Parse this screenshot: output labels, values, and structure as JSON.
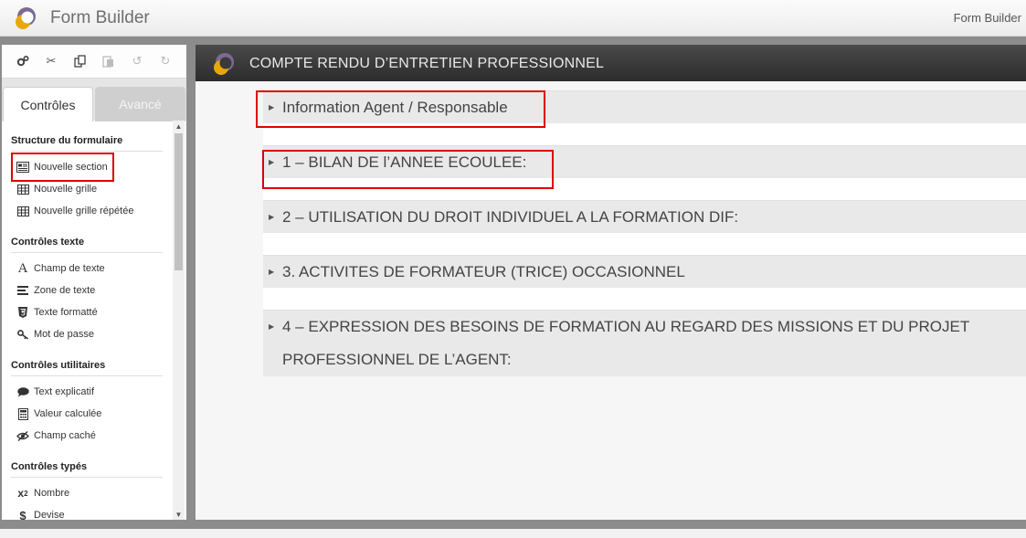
{
  "header": {
    "app_title": "Form Builder",
    "right_label": "Form Builder"
  },
  "toolbar": {
    "icons": [
      "settings-icon",
      "cut-icon",
      "copy-icon",
      "paste-icon",
      "undo-icon",
      "redo-icon"
    ]
  },
  "tabs": {
    "controls": "Contrôles",
    "advanced": "Avancé"
  },
  "sidebar": {
    "structure": {
      "title": "Structure du formulaire",
      "items": [
        "Nouvelle section",
        "Nouvelle grille",
        "Nouvelle grille répétée"
      ]
    },
    "text": {
      "title": "Contrôles texte",
      "items": [
        "Champ de texte",
        "Zone de texte",
        "Texte formatté",
        "Mot de passe"
      ]
    },
    "utility": {
      "title": "Contrôles utilitaires",
      "items": [
        "Text explicatif",
        "Valeur calculée",
        "Champ caché"
      ]
    },
    "typed": {
      "title": "Contrôles typés",
      "items": [
        "Nombre",
        "Devise"
      ]
    }
  },
  "form": {
    "title": "COMPTE RENDU D’ENTRETIEN PROFESSIONNEL",
    "sections": [
      "Information Agent / Responsable",
      "1 – BILAN DE l’ANNEE ECOULEE:",
      "2 – UTILISATION DU DROIT INDIVIDUEL A LA FORMATION DIF:",
      "3. ACTIVITES DE FORMATEUR (TRICE) OCCASIONNEL",
      "4 – EXPRESSION DES BESOINS DE FORMATION AU REGARD DES MISSIONS ET DU PROJET",
      "PROFESSIONNEL DE L’AGENT:"
    ]
  },
  "colors": {
    "highlight": "#dd0000",
    "header_dark": "#333333",
    "logo_purple": "#7b6a93",
    "logo_gold": "#e8a80c"
  }
}
